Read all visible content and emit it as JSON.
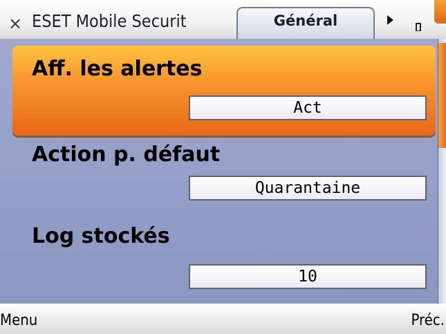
{
  "window": {
    "close_symbol": "×",
    "app_title": "ESET Mobile Securit",
    "tab_label": "Général"
  },
  "icons": {
    "close": "close-icon",
    "tab_next": "arrow-right-icon",
    "indicator": "small-box-icon"
  },
  "settings": {
    "items": [
      {
        "label": "Aff.  les alertes",
        "value": "Act",
        "selected": true
      },
      {
        "label": "Action p. défaut",
        "value": "Quarantaine",
        "selected": false
      },
      {
        "label": "Log stockés",
        "value": "10",
        "selected": false
      }
    ]
  },
  "softkeys": {
    "left": "Menu",
    "right": "Préc."
  },
  "colors": {
    "background": "#8e9cc4",
    "highlight": "#f7962c",
    "accent": "#e46a18"
  }
}
